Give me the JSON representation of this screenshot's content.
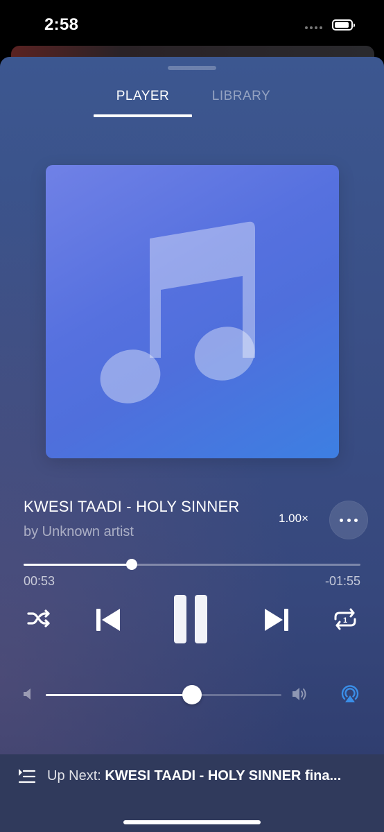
{
  "status_bar": {
    "time": "2:58"
  },
  "tabs": [
    {
      "label": "PLAYER",
      "active": true
    },
    {
      "label": "LIBRARY",
      "active": false
    }
  ],
  "artwork": {
    "icon": "music-note-icon",
    "colors": [
      "#7081e6",
      "#3d7fe2"
    ]
  },
  "track": {
    "title": "KWESI TAADI - HOLY SINNER",
    "artist": "by Unknown artist",
    "speed": "1.00×"
  },
  "playback": {
    "elapsed": "00:53",
    "remaining": "-01:55",
    "progress_fraction": 0.32,
    "state": "playing"
  },
  "controls": {
    "shuffle": "shuffle-icon",
    "previous": "skip-previous-icon",
    "play_pause": "pause-icon",
    "next": "skip-next-icon",
    "repeat": "repeat-one-icon"
  },
  "volume": {
    "level_fraction": 0.62,
    "airplay_color": "#3a8ee8"
  },
  "up_next": {
    "label": "Up Next: ",
    "title": "KWESI TAADI - HOLY SINNER fina..."
  }
}
